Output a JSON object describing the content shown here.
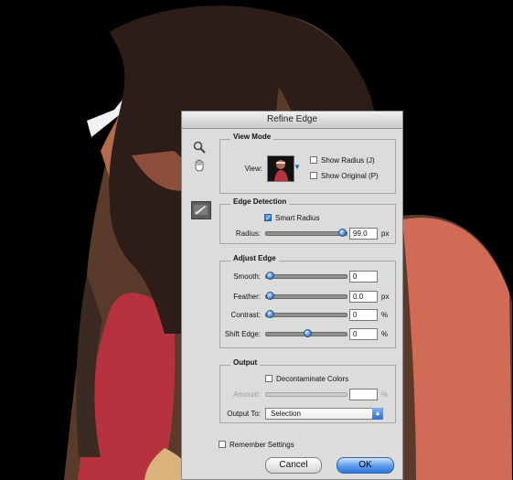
{
  "dialog": {
    "title": "Refine Edge",
    "view_mode": {
      "title": "View Mode",
      "view_label": "View:",
      "show_radius_label": "Show Radius (J)",
      "show_original_label": "Show Original (P)"
    },
    "edge_detection": {
      "title": "Edge Detection",
      "smart_radius_label": "Smart Radius",
      "radius_label": "Radius:",
      "radius_value": "99.0",
      "radius_unit": "px",
      "radius_level": 0.97
    },
    "adjust_edge": {
      "title": "Adjust Edge",
      "smooth_label": "Smooth:",
      "smooth_value": "0",
      "smooth_level": 0,
      "feather_label": "Feather:",
      "feather_value": "0.0",
      "feather_unit": "px",
      "feather_level": 0,
      "contrast_label": "Contrast:",
      "contrast_value": "0",
      "contrast_unit": "%",
      "contrast_level": 0,
      "shift_edge_label": "Shift Edge:",
      "shift_edge_value": "0",
      "shift_edge_unit": "%",
      "shift_edge_level": 0.5
    },
    "output": {
      "title": "Output",
      "decontaminate_label": "Decontaminate Colors",
      "amount_label": "Amount:",
      "amount_value": "",
      "amount_unit": "%",
      "output_to_label": "Output To:",
      "output_to_value": "Selection"
    },
    "remember_settings_label": "Remember Settings",
    "cancel_label": "Cancel",
    "ok_label": "OK"
  },
  "colors": {
    "accent": "#2f74d8"
  },
  "icons": {
    "zoom": "magnifier-icon",
    "hand": "hand-icon",
    "brush": "refine-brush-icon",
    "dropdown": "chevron-down-icon"
  }
}
